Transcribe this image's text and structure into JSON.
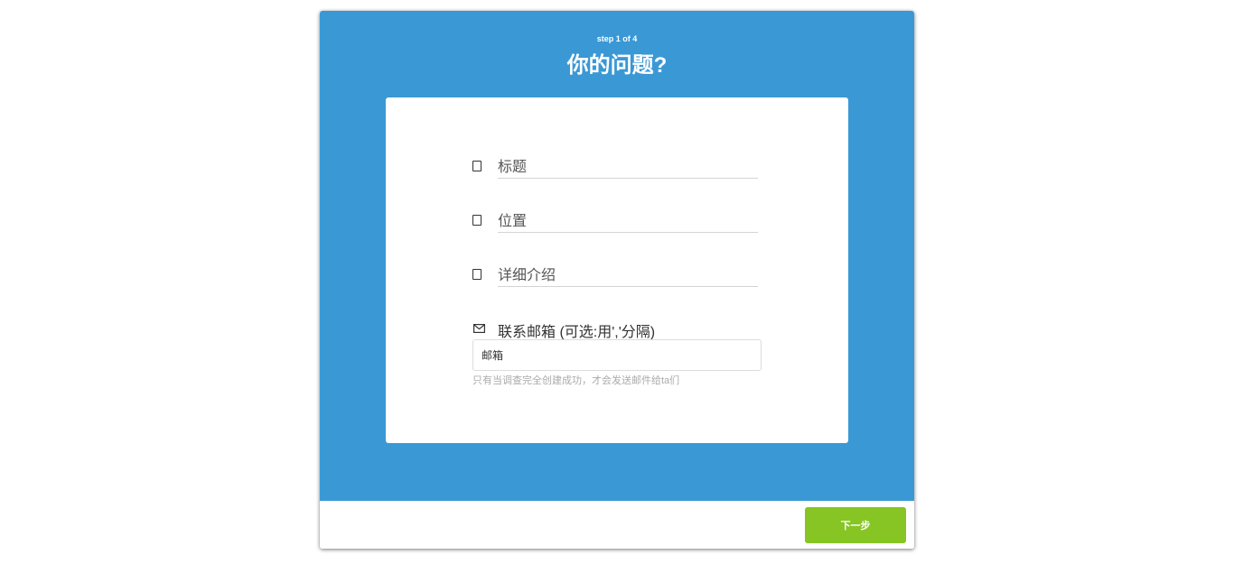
{
  "header": {
    "step": "step 1 of 4",
    "title": "你的问题?"
  },
  "form": {
    "title_field": {
      "placeholder": "标题",
      "icon": "file-icon"
    },
    "location_field": {
      "placeholder": "位置",
      "icon": "file-icon"
    },
    "details_field": {
      "placeholder": "详细介绍",
      "icon": "file-icon"
    },
    "email": {
      "label": "联系邮箱 (可选:用','分隔)",
      "icon": "mail-icon",
      "placeholder": "邮箱",
      "hint": "只有当调查完全创建成功，才会发送邮件给ta们"
    }
  },
  "footer": {
    "next_label": "下一步"
  },
  "colors": {
    "header_bg": "#3a98d5",
    "button_bg": "#86c524"
  }
}
